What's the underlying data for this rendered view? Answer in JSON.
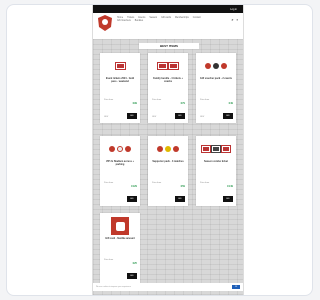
{
  "topbar": {
    "text": "Log in"
  },
  "nav": {
    "items": [
      "Home",
      "Tickets",
      "Events",
      "Season",
      "Gift cards",
      "Memberships",
      "Contact",
      "Gift Vouchers",
      "Bundles"
    ]
  },
  "page_title": "BEST ITEMS",
  "products": [
    {
      "title": "Event tickets 2024 - Gold pass - weekend",
      "meta": "Price from",
      "price": "€99",
      "button": "ADD",
      "tag": "NEW"
    },
    {
      "title": "Family bundle - 4 tickets + snacks",
      "meta": "Price from",
      "price": "€79",
      "button": "ADD",
      "tag": "NEW"
    },
    {
      "title": "Gift voucher pack - 2 events",
      "meta": "Price from",
      "price": "€49",
      "button": "ADD",
      "tag": "NEW"
    },
    {
      "title": "VIP 2x Stadium access + parking",
      "meta": "Price from",
      "price": "€129",
      "button": "ADD",
      "tag": ""
    },
    {
      "title": "Supporter pack - 3 matches",
      "meta": "Price from",
      "price": "€59",
      "button": "ADD",
      "tag": ""
    },
    {
      "title": "Season combo ticket",
      "meta": "Price from",
      "price": "€149",
      "button": "ADD",
      "tag": ""
    },
    {
      "title": "Gift card - flexible amount",
      "meta": "Price from",
      "price": "€25",
      "button": "ADD",
      "tag": ""
    }
  ],
  "footer": {
    "text": "We use cookies to improve your experience",
    "button": "OK"
  },
  "colors": {
    "accent": "#c0392b",
    "price": "#2e9b52",
    "dark": "#111111"
  }
}
